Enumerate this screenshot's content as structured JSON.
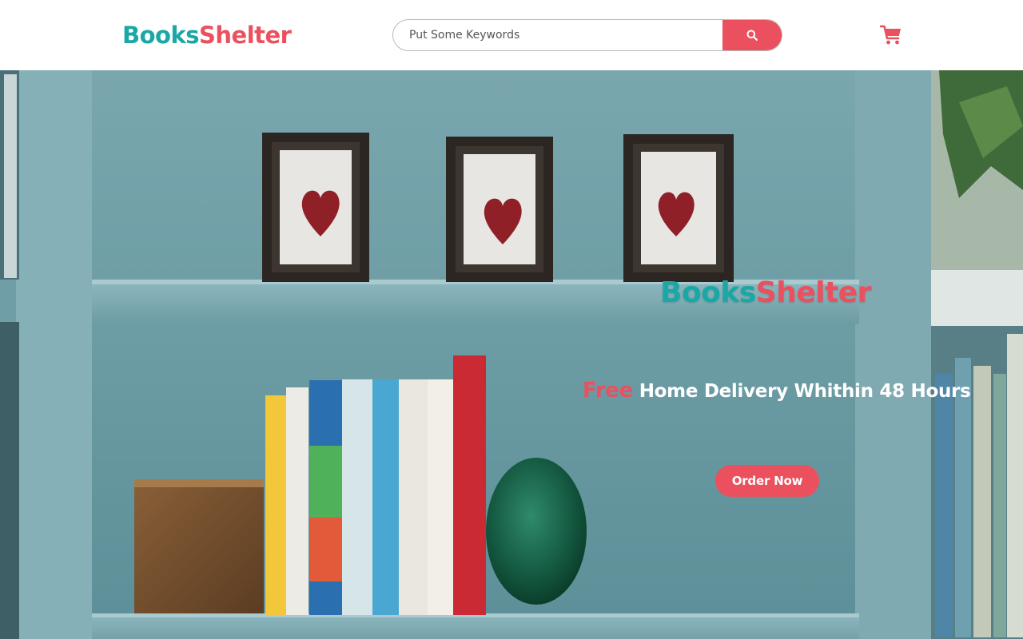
{
  "brand": {
    "part1": "Books",
    "part2": "Shelter"
  },
  "search": {
    "placeholder": "Put Some Keywords",
    "value": ""
  },
  "icons": {
    "search": "search-icon",
    "cart": "cart-icon"
  },
  "hero": {
    "brand_part1": "Books",
    "brand_part2": "Shelter",
    "tagline_highlight": "Free",
    "tagline_rest": " Home Delivery Whithin 48 Hours",
    "cta_label": "Order Now"
  },
  "colors": {
    "teal": "#1aa8a6",
    "coral": "#ea505d",
    "white": "#ffffff"
  }
}
